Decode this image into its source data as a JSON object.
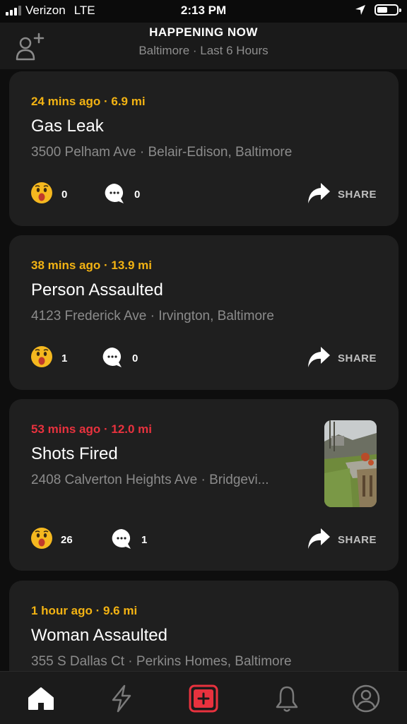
{
  "status_bar": {
    "carrier": "Verizon",
    "network": "LTE",
    "time": "2:13 PM",
    "icons": [
      "signal-icon",
      "location-arrow-icon",
      "battery-icon"
    ]
  },
  "header": {
    "title": "HAPPENING NOW",
    "subtitle": "Baltimore · Last 6 Hours"
  },
  "incidents": [
    {
      "meta": "24 mins ago · 6.9 mi",
      "meta_color": "#f3b313",
      "title": "Gas Leak",
      "address": "3500 Pelham Ave · Belair-Edison, Baltimore",
      "reactions": "0",
      "comments": "0",
      "share_label": "SHARE"
    },
    {
      "meta": "38 mins ago · 13.9 mi",
      "meta_color": "#f3b313",
      "title": "Person Assaulted",
      "address": "4123 Frederick Ave · Irvington, Baltimore",
      "reactions": "1",
      "comments": "0",
      "share_label": "SHARE"
    },
    {
      "meta": "53 mins ago · 12.0 mi",
      "meta_color": "#e8323e",
      "title": "Shots Fired",
      "address": "2408 Calverton Heights Ave · Bridgevi...",
      "reactions": "26",
      "comments": "1",
      "share_label": "SHARE",
      "has_photo": true
    },
    {
      "meta": "1 hour ago · 9.6 mi",
      "meta_color": "#f3b313",
      "title": "Woman Assaulted",
      "address": "355 S Dallas Ct · Perkins Homes, Baltimore"
    }
  ],
  "tab_bar": {
    "tabs": [
      "home-icon",
      "bolt-icon",
      "report-plus-icon",
      "bell-icon",
      "profile-icon"
    ],
    "active": "home-icon",
    "accent": "#e8323e"
  }
}
